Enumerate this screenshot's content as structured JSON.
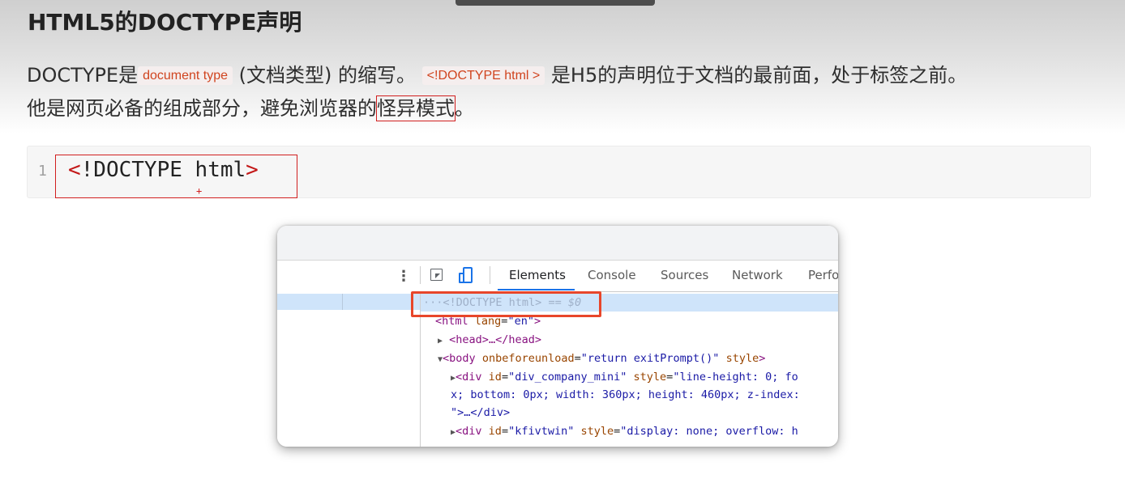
{
  "heading": "HTML5的DOCTYPE声明",
  "para1": {
    "t1": "DOCTYPE是",
    "code1": "document type",
    "t2": " (文档类型) 的缩写。 ",
    "code2": "<!DOCTYPE html >",
    "t3": " 是H5的声明位于文档的最前面，处于标签之前。"
  },
  "para2": {
    "t1": "他是网页必备的组成部分，避免浏览器的",
    "boxed": "怪异模式",
    "t2": "。"
  },
  "codeblock": {
    "line_number": "1",
    "code_lt": "<",
    "code_mid": "!DOCTYPE html",
    "code_gt": ">"
  },
  "devtools": {
    "kebab": "⋮",
    "tabs": [
      "Elements",
      "Console",
      "Sources",
      "Network",
      "Perfo"
    ],
    "active_tab": "Elements",
    "lines": {
      "l1_dots": "···",
      "l1_doctype": "<!DOCTYPE html>",
      "l1_eq": " == $0",
      "l2_open": "<html ",
      "l2_attr": "lang",
      "l2_eq": "=",
      "l2_val": "\"en\"",
      "l2_close": ">",
      "l3_arrow": "▶",
      "l3_text": "<head>…</head>",
      "l4_arrow": "▼",
      "l4_open": "<body ",
      "l4_attr": "onbeforeunload",
      "l4_eq": "=",
      "l4_val": "\"return exitPrompt()\"",
      "l4_attr2": " style",
      "l4_close": ">",
      "l5_arrow": "▶",
      "l5_open": "<div ",
      "l5_attr": "id",
      "l5_val": "\"div_company_mini\"",
      "l5_attr2": " style",
      "l5_val2": "\"line-height: 0; fo",
      "l6_text": "x; bottom: 0px; width: 360px; height: 460px; z-index: ",
      "l7_text": "\">…</div>",
      "l8_arrow": "▶",
      "l8_open": "<div ",
      "l8_attr": "id",
      "l8_val": "\"kfivtwin\"",
      "l8_attr2": " style",
      "l8_val2": "\"display: none; overflow: h"
    }
  },
  "colors": {
    "highlight_red": "#d11f1f",
    "devtools_box_red": "#e8462a",
    "inline_code_text": "#d0441f",
    "selection_blue": "#cfe4fa",
    "tab_underline": "#1a73e8"
  }
}
